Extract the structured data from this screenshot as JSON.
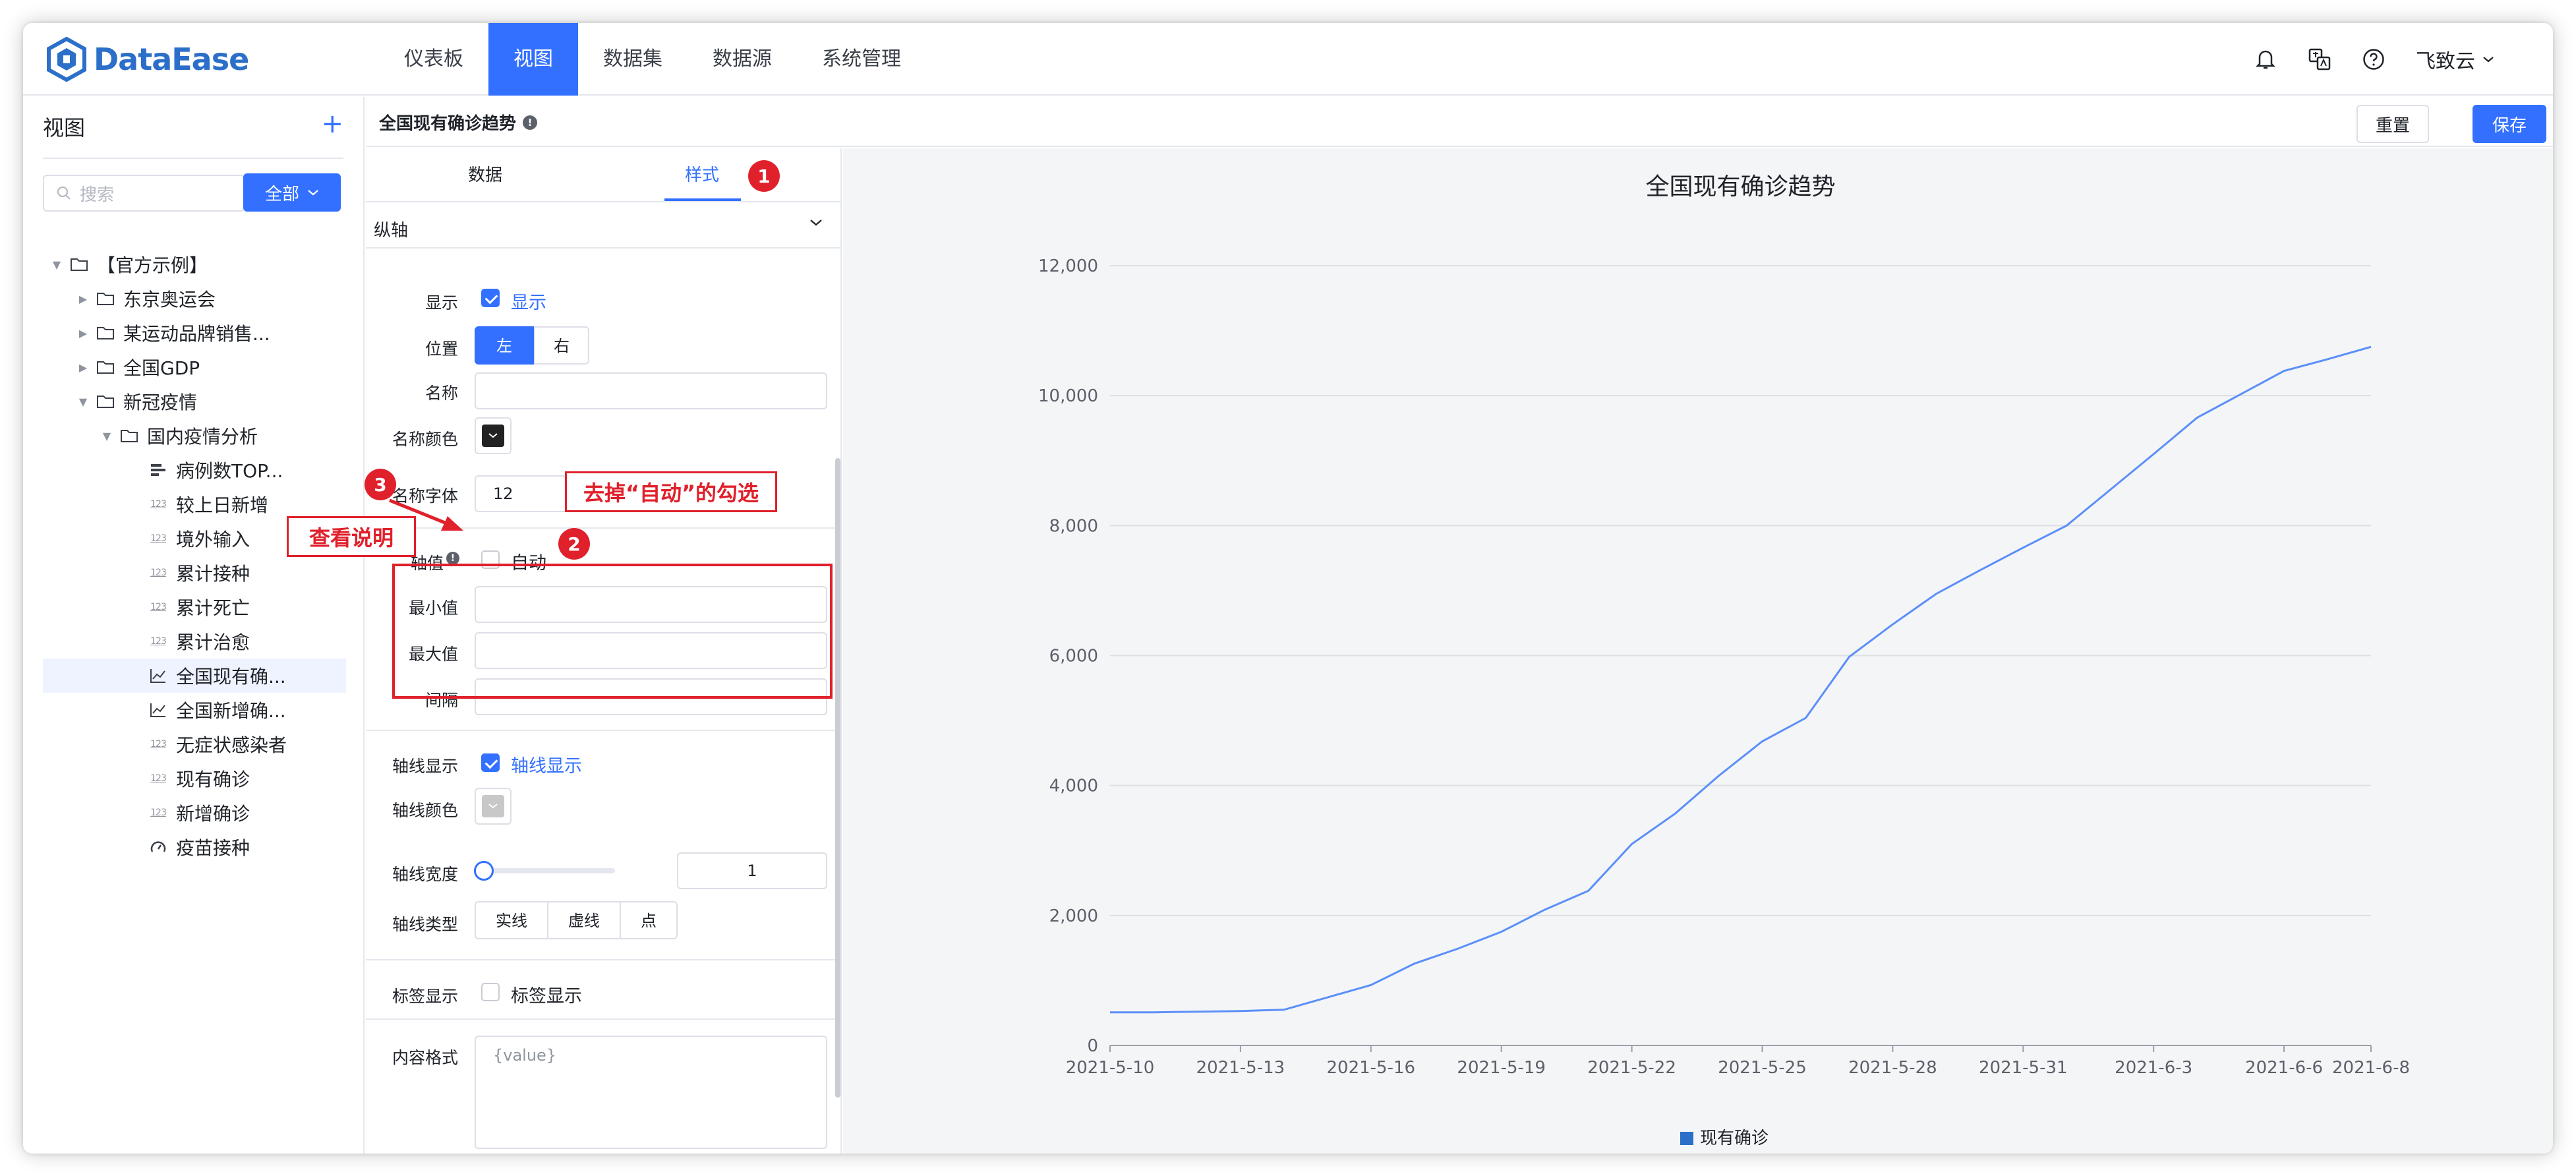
{
  "app": {
    "logo_text": "DataEase",
    "nav": [
      "仪表板",
      "视图",
      "数据集",
      "数据源",
      "系统管理"
    ],
    "active_nav_index": 1,
    "user_name": "飞致云"
  },
  "sidebar": {
    "title": "视图",
    "search_placeholder": "搜索",
    "filter_label": "全部",
    "tree": [
      {
        "label": "【官方示例】",
        "icon": "folder-icon",
        "level": 0,
        "expanded": true
      },
      {
        "label": "东京奥运会",
        "icon": "folder-icon",
        "level": 1,
        "expanded": false
      },
      {
        "label": "某运动品牌销售...",
        "icon": "folder-icon",
        "level": 1,
        "expanded": false
      },
      {
        "label": "全国GDP",
        "icon": "folder-icon",
        "level": 1,
        "expanded": false
      },
      {
        "label": "新冠疫情",
        "icon": "folder-icon",
        "level": 1,
        "expanded": true
      },
      {
        "label": "国内疫情分析",
        "icon": "folder-icon",
        "level": 2,
        "expanded": true
      },
      {
        "label": "病例数TOP...",
        "icon": "bar-chart-icon",
        "level": 3
      },
      {
        "label": "较上日新增",
        "icon": "number-icon",
        "level": 3
      },
      {
        "label": "境外输入",
        "icon": "number-icon",
        "level": 3
      },
      {
        "label": "累计接种",
        "icon": "number-icon",
        "level": 3
      },
      {
        "label": "累计死亡",
        "icon": "number-icon",
        "level": 3
      },
      {
        "label": "累计治愈",
        "icon": "number-icon",
        "level": 3
      },
      {
        "label": "全国现有确...",
        "icon": "line-chart-icon",
        "level": 3,
        "selected": true
      },
      {
        "label": "全国新增确...",
        "icon": "line-chart-icon",
        "level": 3
      },
      {
        "label": "无症状感染者",
        "icon": "number-icon",
        "level": 3
      },
      {
        "label": "现有确诊",
        "icon": "number-icon",
        "level": 3
      },
      {
        "label": "新增确诊",
        "icon": "number-icon",
        "level": 3
      },
      {
        "label": "疫苗接种",
        "icon": "gauge-icon",
        "level": 3
      }
    ]
  },
  "header": {
    "chart_name": "全国现有确诊趋势",
    "reset_label": "重置",
    "save_label": "保存"
  },
  "config": {
    "tabs": [
      "数据",
      "样式"
    ],
    "active_tab": 1,
    "section_title": "纵轴",
    "show_label": "显示",
    "show_checkbox_label": "显示",
    "position_label": "位置",
    "position_options": [
      "左",
      "右"
    ],
    "name_label": "名称",
    "name_value": "",
    "name_color_label": "名称颜色",
    "name_color": "#222222",
    "name_font_label": "名称字体",
    "name_font_value": "12",
    "axis_value_label": "轴值",
    "auto_label": "自动",
    "auto_checked": false,
    "min_label": "最小值",
    "max_label": "最大值",
    "interval_label": "间隔",
    "axisline_show_label": "轴线显示",
    "axisline_show_checkbox": "轴线显示",
    "axisline_color_label": "轴线颜色",
    "axisline_color": "#c8c8c8",
    "axisline_width_label": "轴线宽度",
    "axisline_width_value": "1",
    "axisline_width_fraction": 0.0,
    "axisline_type_label": "轴线类型",
    "axisline_type_options": [
      "实线",
      "虚线",
      "点"
    ],
    "label_show_label": "标签显示",
    "label_show_checkbox": "标签显示",
    "content_format_label": "内容格式",
    "content_format_value": "{value}"
  },
  "annotations": {
    "badge1": "1",
    "badge2": "2",
    "badge3": "3",
    "callout_uncheck": "去掉“自动”的勾选",
    "callout_view": "查看说明"
  },
  "colors": {
    "accent": "#3370ff",
    "annotation": "#e0202b",
    "series": "#5b8ff9"
  },
  "chart_data": {
    "type": "line",
    "title": "全国现有确诊趋势",
    "x": [
      "2021-5-10",
      "2021-5-11",
      "2021-5-12",
      "2021-5-13",
      "2021-5-14",
      "2021-5-15",
      "2021-5-16",
      "2021-5-17",
      "2021-5-18",
      "2021-5-19",
      "2021-5-20",
      "2021-5-21",
      "2021-5-22",
      "2021-5-23",
      "2021-5-24",
      "2021-5-25",
      "2021-5-26",
      "2021-5-27",
      "2021-5-28",
      "2021-5-29",
      "2021-5-30",
      "2021-5-31",
      "2021-6-1",
      "2021-6-2",
      "2021-6-3",
      "2021-6-4",
      "2021-6-5",
      "2021-6-6",
      "2021-6-7",
      "2021-6-8"
    ],
    "x_tick_labels": [
      "2021-5-10",
      "2021-5-13",
      "2021-5-16",
      "2021-5-19",
      "2021-5-22",
      "2021-5-25",
      "2021-5-28",
      "2021-5-31",
      "2021-6-3",
      "2021-6-6",
      "2021-6-8"
    ],
    "series": [
      {
        "name": "现有确诊",
        "values": [
          510,
          510,
          520,
          530,
          550,
          740,
          930,
          1260,
          1490,
          1750,
          2090,
          2380,
          3100,
          3570,
          4150,
          4680,
          5040,
          5980,
          6480,
          6950,
          7310,
          7660,
          8000,
          8550,
          9100,
          9660,
          10020,
          10380,
          10560,
          10750
        ]
      }
    ],
    "ylim": [
      0,
      12000
    ],
    "y_ticks": [
      0,
      2000,
      4000,
      6000,
      8000,
      10000,
      12000
    ],
    "y_tick_labels": [
      "0",
      "2,000",
      "4,000",
      "6,000",
      "8,000",
      "10,000",
      "12,000"
    ],
    "grid": true,
    "legend": "bottom-center"
  }
}
